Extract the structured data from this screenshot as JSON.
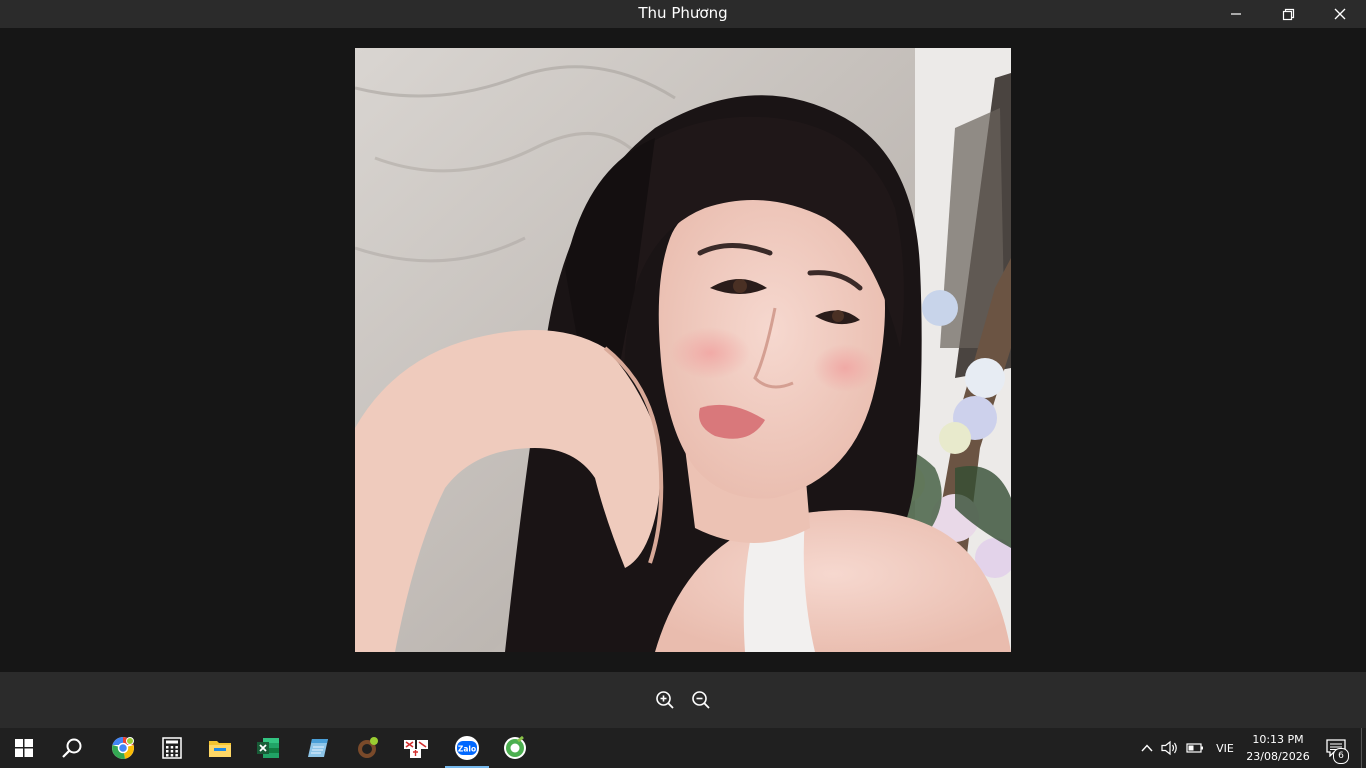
{
  "window": {
    "title": "Thu Phương"
  },
  "viewer": {
    "zoom_in_icon": "zoom-in-icon",
    "zoom_out_icon": "zoom-out-icon"
  },
  "taskbar": {
    "apps": [
      "start",
      "search",
      "chrome",
      "calculator",
      "file-explorer",
      "excel",
      "notepad",
      "app-brown",
      "unikey",
      "zalo",
      "app-green"
    ],
    "active_app": "zalo",
    "tray": {
      "language": "VIE",
      "time": "10:13 PM",
      "date": "23/08/2026",
      "notification_count": "6"
    }
  },
  "colors": {
    "titlebar_bg": "#2b2b2b",
    "viewer_bg": "#161616",
    "taskbar_bg": "#202020",
    "accent": "#76b9ed"
  }
}
